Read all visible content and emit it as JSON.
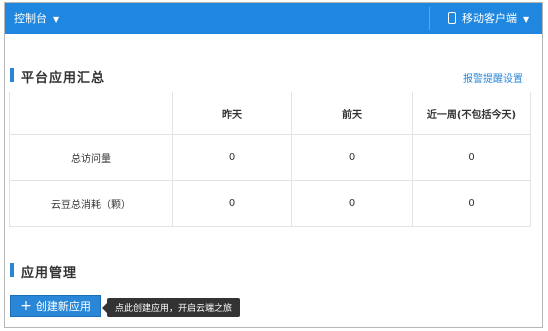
{
  "topbar": {
    "console_label": "控制台",
    "mobile_label": "移动客户端"
  },
  "summary": {
    "title": "平台应用汇总",
    "alarm_link": "报警提醒设置",
    "columns": [
      "",
      "昨天",
      "前天",
      "近一周(不包括今天)"
    ],
    "rows": [
      {
        "label": "总访问量",
        "values": [
          "0",
          "0",
          "0"
        ]
      },
      {
        "label": "云豆总消耗（颗）",
        "values": [
          "0",
          "0",
          "0"
        ]
      }
    ]
  },
  "app_mgmt": {
    "title": "应用管理",
    "create_button": "创建新应用",
    "tooltip": "点此创建应用，开启云端之旅"
  }
}
